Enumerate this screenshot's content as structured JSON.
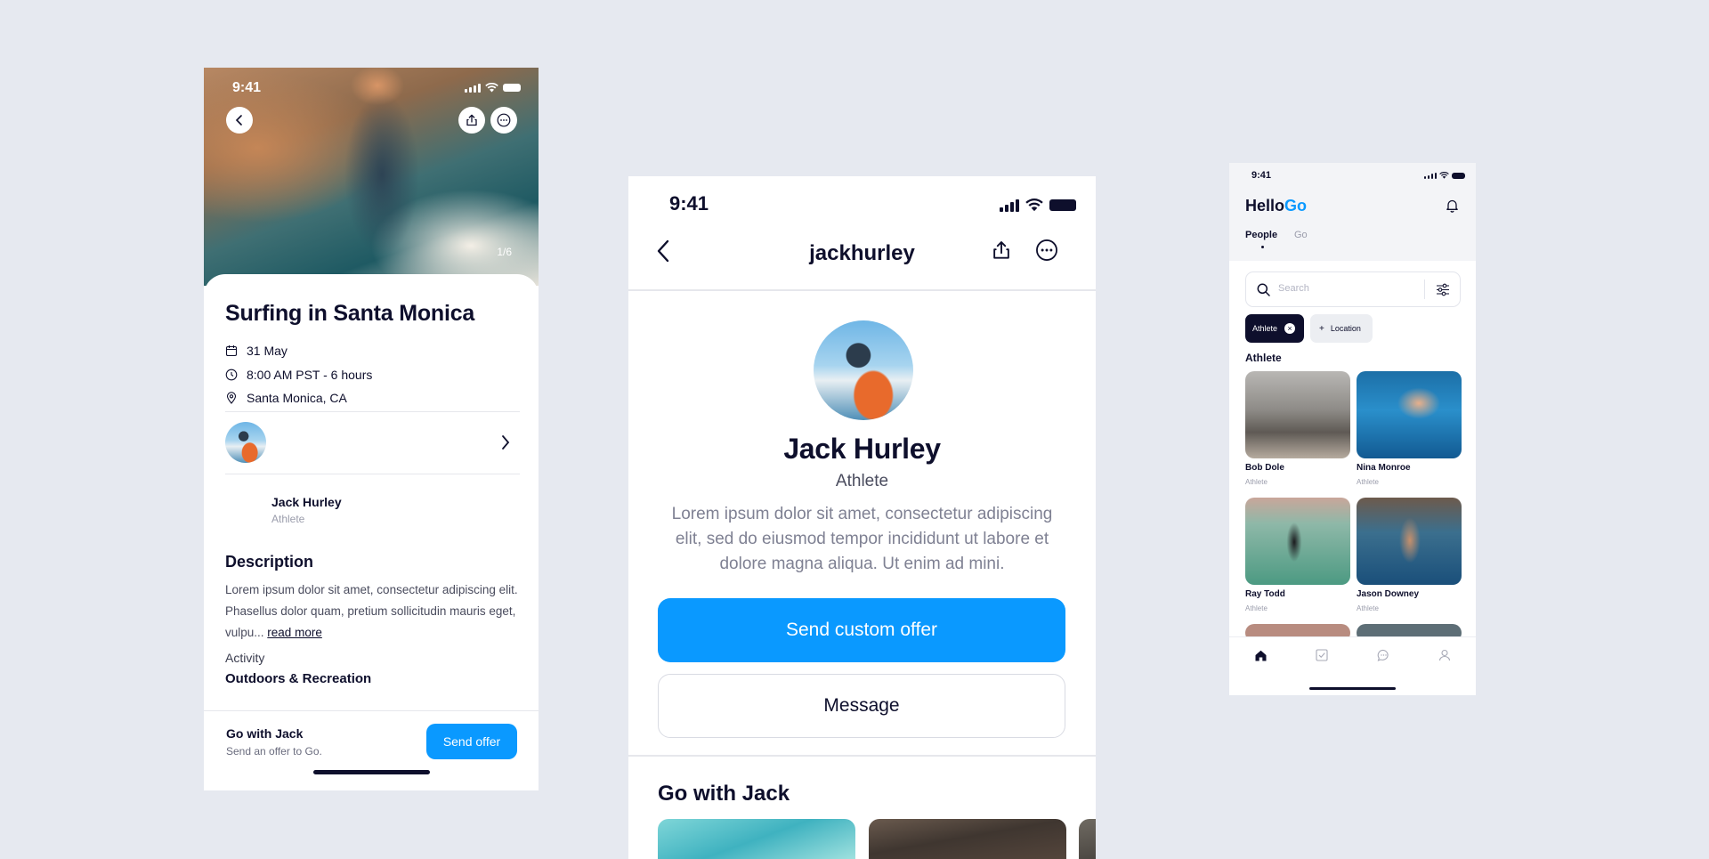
{
  "screen1": {
    "status_time": "9:41",
    "photo_counter": "1/6",
    "title": "Surfing in Santa Monica",
    "date": "31 May",
    "time_range": "8:00 AM PST - 6 hours",
    "location": "Santa Monica, CA",
    "host_name": "Jack Hurley",
    "host_role": "Athlete",
    "description_heading": "Description",
    "description": "Lorem ipsum dolor sit amet, consectetur adipiscing elit. Phasellus dolor quam, pretium sollicitudin mauris eget, vulpu...",
    "read_more": "read more",
    "activity_label": "Activity",
    "activity_value": "Outdoors & Recreation",
    "footer_title": "Go with Jack",
    "footer_subtitle": "Send an offer to Go.",
    "send_offer": "Send offer"
  },
  "screen2": {
    "status_time": "9:41",
    "username": "jackhurley",
    "name": "Jack Hurley",
    "role": "Athlete",
    "bio": "Lorem ipsum dolor sit amet, consectetur adipiscing elit, sed do eiusmod tempor incididunt ut labore et dolore magna aliqua. Ut enim ad mini.",
    "primary_button": "Send custom offer",
    "secondary_button": "Message",
    "section_heading": "Go with Jack"
  },
  "screen3": {
    "status_time": "9:41",
    "brand_hello": "Hello",
    "brand_go": "Go",
    "tabs": [
      "People",
      "Go"
    ],
    "active_tab": "People",
    "search_placeholder": "Search",
    "chips": [
      "Athlete",
      "Location"
    ],
    "section": "Athlete",
    "people": [
      {
        "name": "Bob Dole",
        "role": "Athlete"
      },
      {
        "name": "Nina Monroe",
        "role": "Athlete"
      },
      {
        "name": "Ray Todd",
        "role": "Athlete"
      },
      {
        "name": "Jason Downey",
        "role": "Athlete"
      }
    ],
    "tabbar": [
      "home-icon",
      "checkbox-icon",
      "chat-icon",
      "profile-icon"
    ]
  },
  "colors": {
    "accent": "#0A99FF",
    "ink": "#0E0F2C",
    "background": "#E6E9F0"
  }
}
